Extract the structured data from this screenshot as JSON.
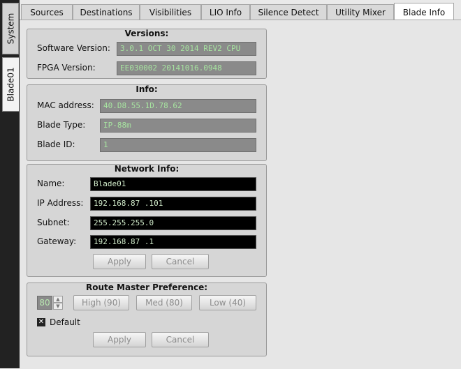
{
  "side_tabs": {
    "system": "System",
    "blade": "Blade01"
  },
  "tabs": [
    "Sources",
    "Destinations",
    "Visibilities",
    "LIO Info",
    "Silence Detect",
    "Utility Mixer",
    "Blade Info"
  ],
  "active_tab": "Blade Info",
  "versions": {
    "title": "Versions:",
    "software_label": "Software Version:",
    "software_value": "3.0.1  OCT 30 2014 REV2 CPU",
    "fpga_label": "FPGA Version:",
    "fpga_value": "EE030002 20141016.0948"
  },
  "info": {
    "title": "Info:",
    "mac_label": "MAC address:",
    "mac_value": "40.D8.55.1D.78.62",
    "type_label": "Blade Type:",
    "type_value": "IP-88m",
    "id_label": "Blade ID:",
    "id_value": "1"
  },
  "network": {
    "title": "Network Info:",
    "name_label": "Name:",
    "name_value": "Blade01",
    "ip_label": "IP Address:",
    "ip_value": "192.168.87 .101",
    "subnet_label": "Subnet:",
    "subnet_value": "255.255.255.0",
    "gateway_label": "Gateway:",
    "gateway_value": "192.168.87 .1",
    "apply": "Apply",
    "cancel": "Cancel"
  },
  "route": {
    "title": "Route Master Preference:",
    "value": "80",
    "high": "High (90)",
    "med": "Med (80)",
    "low": "Low (40)",
    "default_label": "Default",
    "default_checked": true,
    "apply": "Apply",
    "cancel": "Cancel"
  }
}
